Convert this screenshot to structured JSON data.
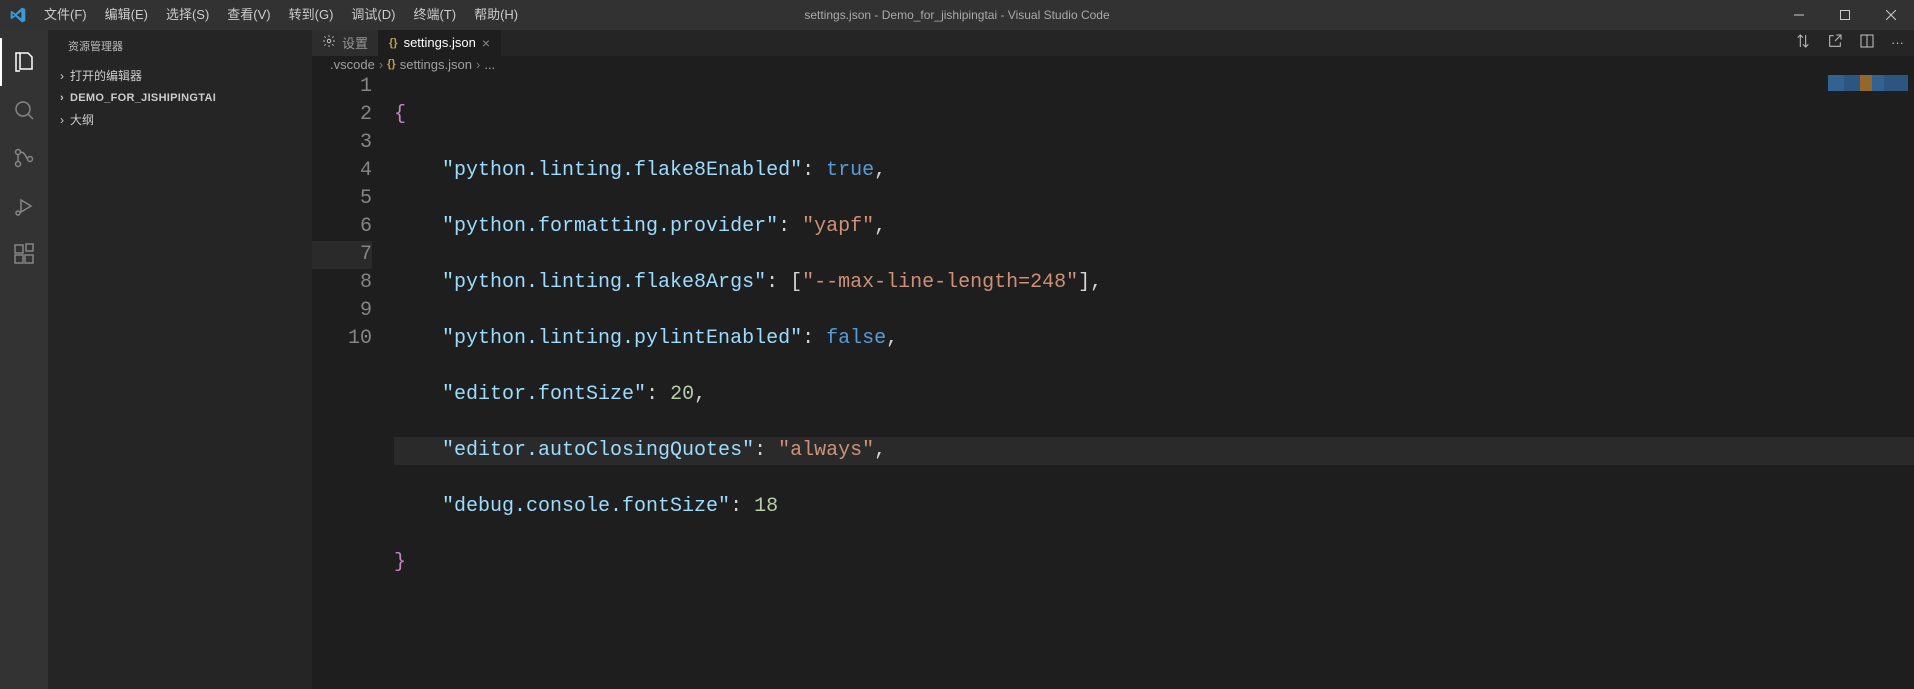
{
  "window": {
    "title": "settings.json - Demo_for_jishipingtai - Visual Studio Code"
  },
  "menu": {
    "file": "文件(F)",
    "edit": "编辑(E)",
    "select": "选择(S)",
    "view": "查看(V)",
    "goto": "转到(G)",
    "debug": "调试(D)",
    "terminal": "终端(T)",
    "help": "帮助(H)"
  },
  "sidebar": {
    "header": "资源管理器",
    "openEditors": "打开的编辑器",
    "folder": "DEMO_FOR_JISHIPINGTAI",
    "outline": "大纲"
  },
  "tabs": {
    "settingsUi": "设置",
    "settingsJson": "settings.json"
  },
  "breadcrumbs": {
    "seg0": ".vscode",
    "seg1": "settings.json",
    "seg2": "..."
  },
  "lineNumbers": [
    "1",
    "2",
    "3",
    "4",
    "5",
    "6",
    "7",
    "8",
    "9",
    "10"
  ],
  "code": {
    "k1": "\"python.linting.flake8Enabled\"",
    "v1": "true",
    "k2": "\"python.formatting.provider\"",
    "v2": "\"yapf\"",
    "k3": "\"python.linting.flake8Args\"",
    "v3": "\"--max-line-length=248\"",
    "k4": "\"python.linting.pylintEnabled\"",
    "v4": "false",
    "k5": "\"editor.fontSize\"",
    "v5": "20",
    "k6": "\"editor.autoClosingQuotes\"",
    "v6": "\"always\"",
    "k7": "\"debug.console.fontSize\"",
    "v7": "18",
    "openBrace": "{",
    "closeBrace": "}",
    "colon": ": ",
    "comma": ",",
    "arrOpen": "[",
    "arrClose": "]"
  }
}
